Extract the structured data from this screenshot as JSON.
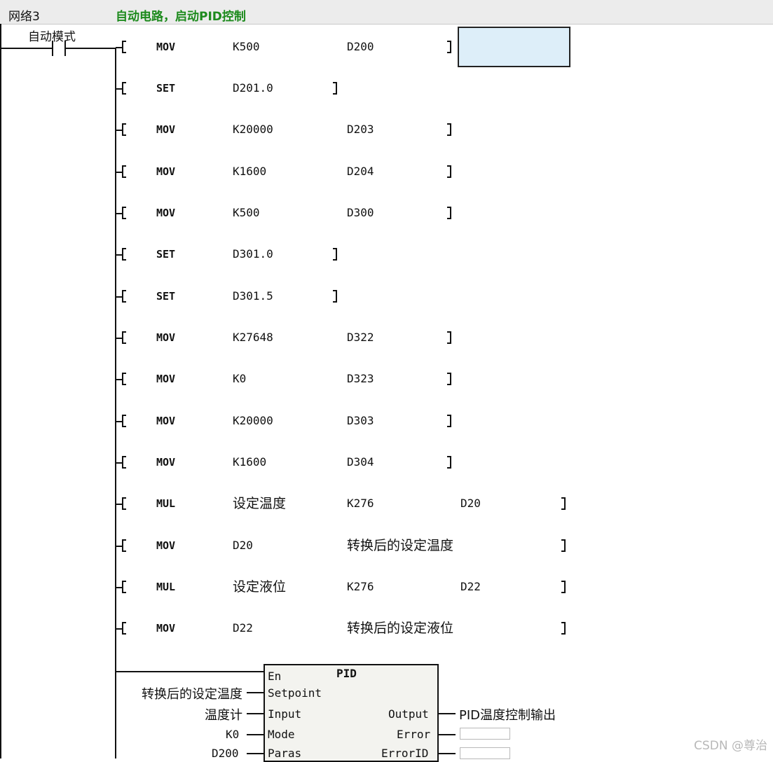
{
  "network": {
    "title": "网络3",
    "comment": "自动电路，启动PID控制"
  },
  "contact": {
    "label": "自动模式"
  },
  "instructions": [
    {
      "op": "MOV",
      "args": [
        "K500",
        "D200"
      ]
    },
    {
      "op": "SET",
      "args": [
        "D201.0"
      ]
    },
    {
      "op": "MOV",
      "args": [
        "K20000",
        "D203"
      ]
    },
    {
      "op": "MOV",
      "args": [
        "K1600",
        "D204"
      ]
    },
    {
      "op": "MOV",
      "args": [
        "K500",
        "D300"
      ]
    },
    {
      "op": "SET",
      "args": [
        "D301.0"
      ]
    },
    {
      "op": "SET",
      "args": [
        "D301.5"
      ]
    },
    {
      "op": "MOV",
      "args": [
        "K27648",
        "D322"
      ]
    },
    {
      "op": "MOV",
      "args": [
        "K0",
        "D323"
      ]
    },
    {
      "op": "MOV",
      "args": [
        "K20000",
        "D303"
      ]
    },
    {
      "op": "MOV",
      "args": [
        "K1600",
        "D304"
      ]
    },
    {
      "op": "MUL",
      "args": [
        "设定温度",
        "K276",
        "D20"
      ]
    },
    {
      "op": "MOV",
      "args": [
        "D20",
        "转换后的设定温度"
      ]
    },
    {
      "op": "MUL",
      "args": [
        "设定液位",
        "K276",
        "D22"
      ]
    },
    {
      "op": "MOV",
      "args": [
        "D22",
        "转换后的设定液位"
      ]
    }
  ],
  "pid_block": {
    "title": "PID",
    "pins_left": [
      "En",
      "Setpoint",
      "Input",
      "Mode",
      "Paras"
    ],
    "pins_right": [
      "Output",
      "Error",
      "ErrorID"
    ],
    "inputs": {
      "setpoint": "转换后的设定温度",
      "input": "温度计",
      "mode": "K0",
      "paras": "D200"
    },
    "outputs": {
      "output": "PID温度控制输出"
    }
  },
  "watermark": "CSDN @尊治"
}
